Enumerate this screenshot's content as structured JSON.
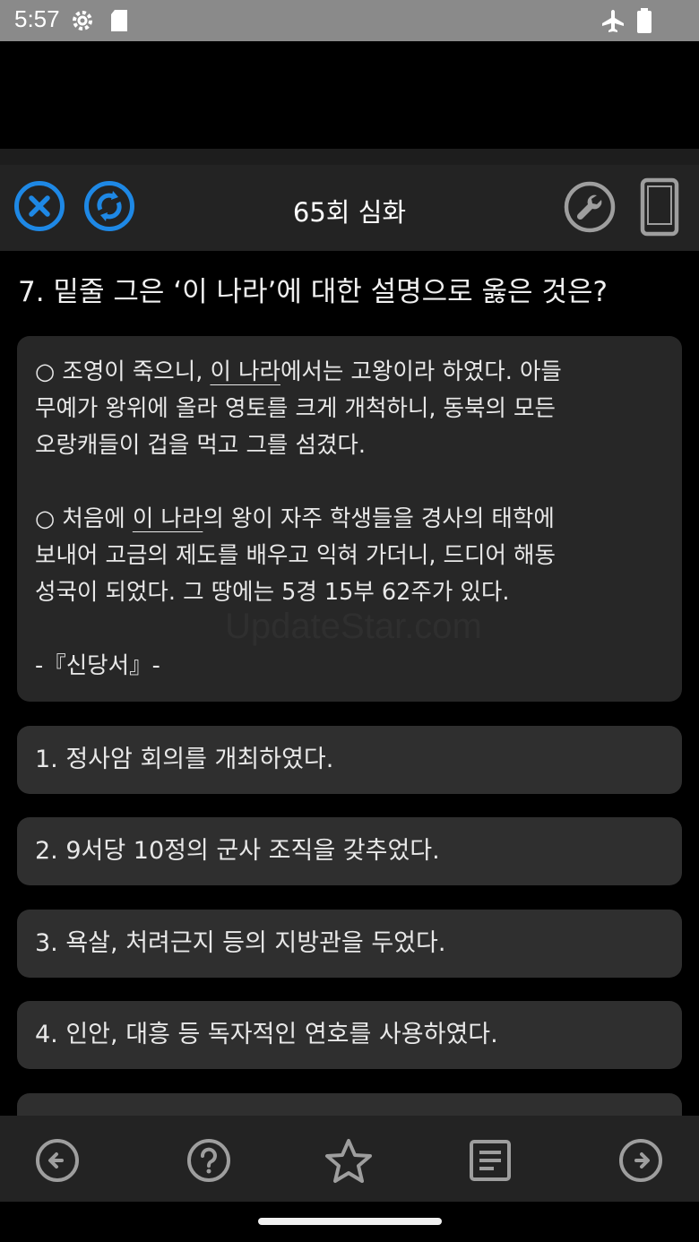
{
  "status": {
    "time": "5:57"
  },
  "header": {
    "title": "65회 심화",
    "icons": [
      "close-circle-icon",
      "refresh-circle-icon",
      "wrench-icon",
      "phone-icon"
    ]
  },
  "question": {
    "text": "7. 밑줄 그은 ‘이 나라’에 대한 설명으로 옳은 것은?"
  },
  "passage": {
    "p1": {
      "l1_pre": "○ 조영이 죽으니, ",
      "l1_ul": "이 나라",
      "l1_post": "에서는 고왕이라 하였다. 아들",
      "l2": "무예가 왕위에 올라 영토를 크게 개척하니, 동북의 모든",
      "l3": "오랑캐들이 겁을 먹고 그를 섬겼다."
    },
    "p2": {
      "l1_pre": "○ 처음에 ",
      "l1_ul": "이 나라",
      "l1_post": "의 왕이 자주 학생들을 경사의 태학에",
      "l2": "보내어 고금의 제도를 배우고 익혀 가더니, 드디어 해동",
      "l3": "성국이 되었다. 그 땅에는 5경 15부 62주가 있다."
    },
    "source": "-『신당서』-",
    "watermark": "UpdateStar.com"
  },
  "options": [
    "1. 정사암 회의를 개최하였다.",
    "2. 9서당 10정의 군사 조직을 갖추었다.",
    "3. 욕살, 처려근지 등의 지방관을 두었다.",
    "4. 인안, 대흥 등 독자적인 연호를 사용하였다."
  ],
  "bottom_nav": [
    "arrow-left-circle-icon",
    "help-circle-icon",
    "star-icon",
    "notes-icon",
    "arrow-right-circle-icon"
  ],
  "colors": {
    "accent_blue": "#1e88e5",
    "icon_gray": "#9e9e9e",
    "background": "#000000",
    "card": "#2f2f2f"
  }
}
